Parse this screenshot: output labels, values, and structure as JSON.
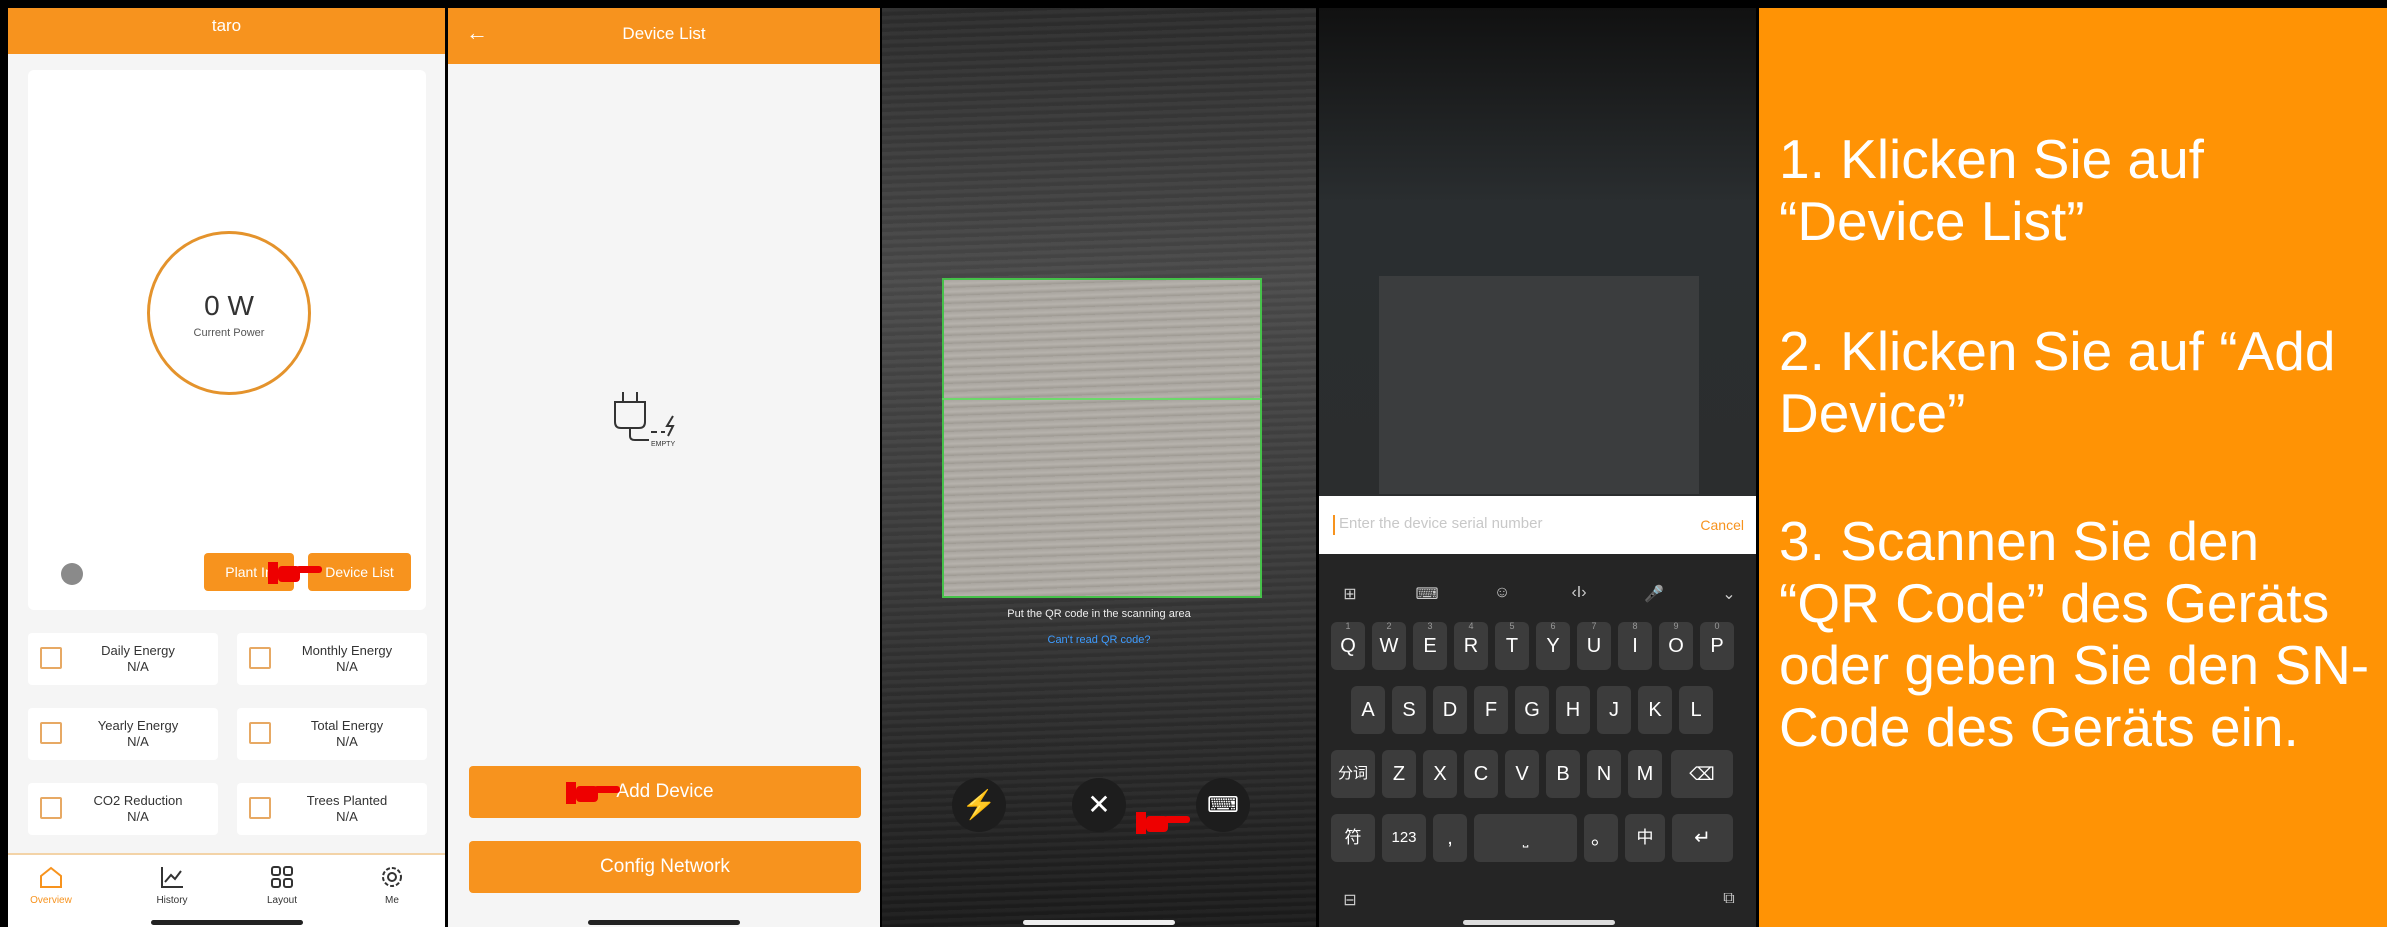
{
  "colors": {
    "accent": "#f7931e",
    "instructions_bg": "#ff9305",
    "scan_frame": "#46c24a",
    "link": "#3e9cff"
  },
  "overview": {
    "title": "taro",
    "power_value": "0 W",
    "power_label": "Current Power",
    "plant_info_button": "Plant In",
    "device_list_button": "Device List",
    "stats": [
      {
        "label": "Daily Energy",
        "value": "N/A",
        "icon": "calendar-icon"
      },
      {
        "label": "Monthly Energy",
        "value": "N/A",
        "icon": "calendar-grid-icon"
      },
      {
        "label": "Yearly Energy",
        "value": "N/A",
        "icon": "bar-chart-icon"
      },
      {
        "label": "Total Energy",
        "value": "N/A",
        "icon": "line-chart-icon"
      },
      {
        "label": "CO2 Reduction",
        "value": "N/A",
        "icon": "co2-cloud-icon"
      },
      {
        "label": "Trees Planted",
        "value": "N/A",
        "icon": "trees-icon"
      }
    ],
    "nav": [
      {
        "label": "Overview",
        "icon": "home-icon"
      },
      {
        "label": "History",
        "icon": "chart-icon"
      },
      {
        "label": "Layout",
        "icon": "grid-icon"
      },
      {
        "label": "Me",
        "icon": "gear-icon"
      }
    ]
  },
  "device_list": {
    "title": "Device List",
    "empty_label": "EMPTY",
    "add_button": "Add Device",
    "config_button": "Config Network"
  },
  "scanner": {
    "hint": "Put the QR code in the scanning area",
    "cant_read": "Can't read QR code?"
  },
  "serial_input": {
    "placeholder": "Enter the device serial number",
    "cancel": "Cancel",
    "row1": [
      "Q",
      "W",
      "E",
      "R",
      "T",
      "Y",
      "U",
      "I",
      "O",
      "P"
    ],
    "row1_sup": [
      "1",
      "2",
      "3",
      "4",
      "5",
      "6",
      "7",
      "8",
      "9",
      "0"
    ],
    "row2": [
      "A",
      "S",
      "D",
      "F",
      "G",
      "H",
      "J",
      "K",
      "L"
    ],
    "row3": [
      "Z",
      "X",
      "C",
      "V",
      "B",
      "N",
      "M"
    ],
    "fenci": "分词",
    "fu": "符",
    "num": "123",
    "comma": ",",
    "period": "。",
    "zhong": "中"
  },
  "instructions": [
    "1. Klicken Sie auf\n  “Device List”",
    "2. Klicken Sie auf  “Add Device”",
    "3. Scannen Sie den\n  “QR Code”   des Geräts oder geben Sie den SN-Code des Geräts ein."
  ]
}
